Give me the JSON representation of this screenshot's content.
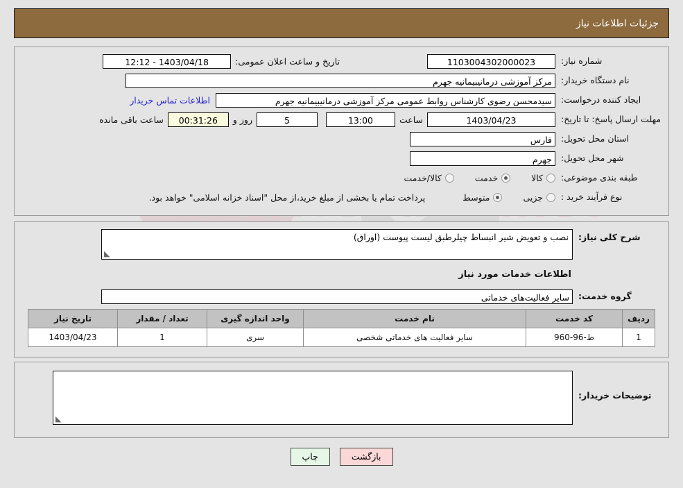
{
  "header": {
    "title": "جزئیات اطلاعات نیاز"
  },
  "form": {
    "need_number_label": "شماره نیاز:",
    "need_number_value": "1103004302000023",
    "announce_datetime_label": "تاریخ و ساعت اعلان عمومی:",
    "announce_datetime_value": "1403/04/18 - 12:12",
    "buyer_org_label": "نام دستگاه خریدار:",
    "buyer_org_value": "مرکز آموزشی درمانیبیمانیه جهرم",
    "creator_label": "ایجاد کننده درخواست:",
    "creator_value": "سیدمحسن رضوی کارشناس روابط عمومی مرکز آموزشی درمانیبیمانیه جهرم",
    "contact_link": "اطلاعات تماس خریدار",
    "deadline_label": "مهلت ارسال پاسخ: تا تاریخ:",
    "deadline_date": "1403/04/23",
    "deadline_time_label": "ساعت",
    "deadline_time": "13:00",
    "remaining_days": "5",
    "remaining_days_label": "روز و",
    "remaining_time": "00:31:26",
    "remaining_time_label": "ساعت باقی مانده",
    "province_label": "استان محل تحویل:",
    "province_value": "فارس",
    "city_label": "شهر محل تحویل:",
    "city_value": "جهرم",
    "category_label": "طبقه بندی موضوعی:",
    "category_options": [
      {
        "label": "کالا",
        "selected": false
      },
      {
        "label": "خدمت",
        "selected": true
      },
      {
        "label": "کالا/خدمت",
        "selected": false
      }
    ],
    "process_label": "نوع فرآیند خرید :",
    "process_options": [
      {
        "label": "جزیی",
        "selected": false
      },
      {
        "label": "متوسط",
        "selected": true
      }
    ],
    "payment_note": "پرداخت تمام یا بخشی از مبلغ خرید،از محل \"اسناد خزانه اسلامی\" خواهد بود."
  },
  "mid": {
    "general_desc_label": "شرح کلی نیاز:",
    "general_desc_value": "نصب و تعویض شیر انبساط چیلرطبق لیست پیوست  (اوراق)",
    "services_section_title": "اطلاعات خدمات مورد نیاز",
    "service_group_label": "گروه خدمت:",
    "service_group_value": "سایر فعالیت‌های خدماتی",
    "table": {
      "columns": [
        "ردیف",
        "کد خدمت",
        "نام خدمت",
        "واحد اندازه گیری",
        "تعداد / مقدار",
        "تاریخ نیاز"
      ],
      "rows": [
        {
          "index": "1",
          "code": "ط-96-960",
          "name": "سایر فعالیت های خدماتی شخصی",
          "unit": "سری",
          "quantity": "1",
          "need_date": "1403/04/23"
        }
      ]
    }
  },
  "bottom": {
    "buyer_notes_label": "توضیحات خریدار:",
    "buyer_notes_value": ""
  },
  "buttons": {
    "back": "بازگشت",
    "print": "چاپ"
  },
  "watermark": {
    "text": "AriaTender.net"
  },
  "colors": {
    "header_bg": "#8d6b3f",
    "page_bg": "#e4e4e4",
    "link": "#2020d0",
    "back_btn": "#fbd8d8",
    "print_btn": "#e6f7e6",
    "timer_bg": "#fbfbe0",
    "table_header_bg": "#c2c2c2"
  }
}
